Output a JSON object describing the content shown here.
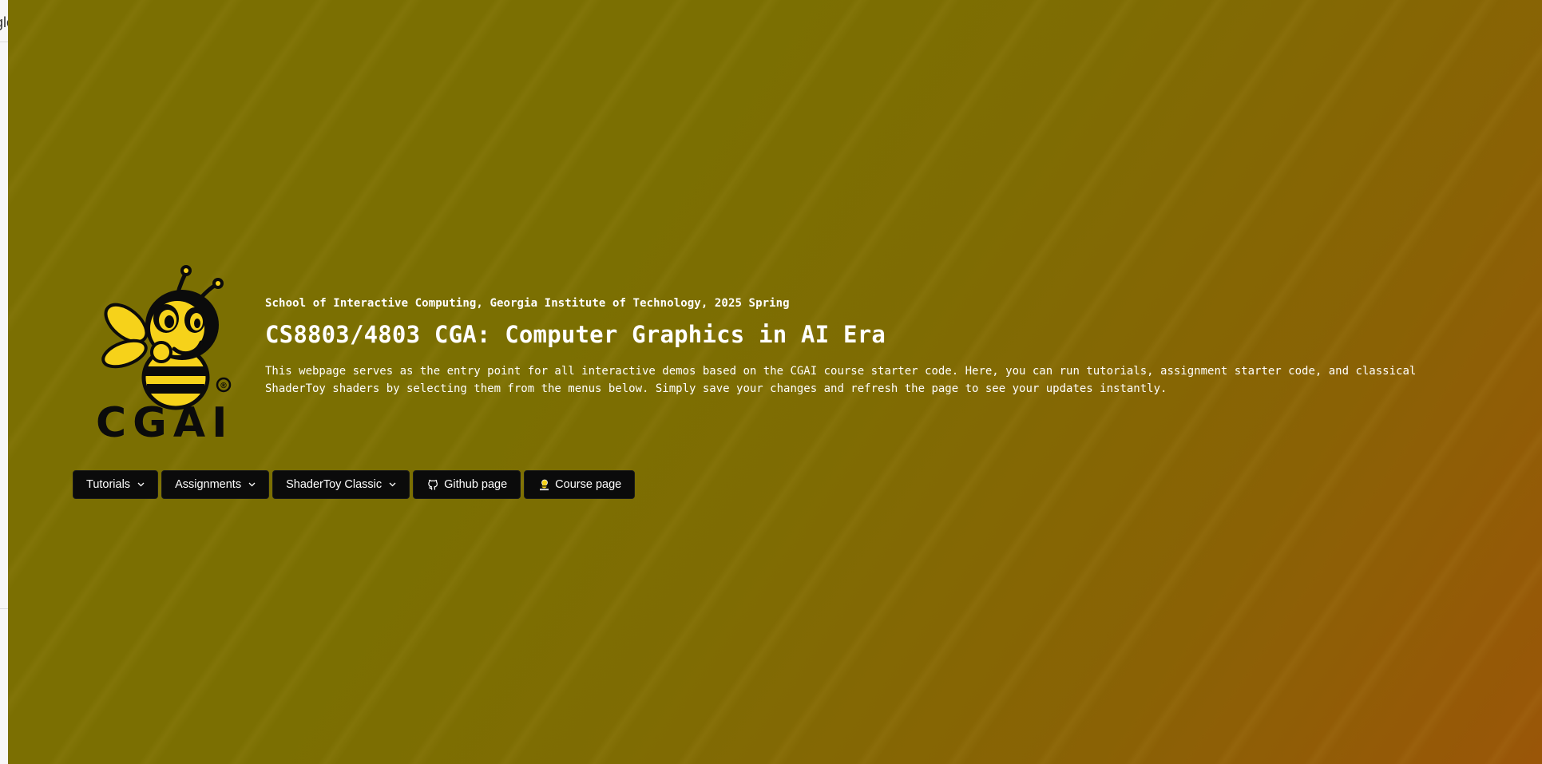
{
  "edge": {
    "fragment_text": "gle"
  },
  "header": {
    "subtitle": "School of Interactive Computing, Georgia Institute of Technology, 2025 Spring",
    "title": "CS8803/4803 CGA: Computer Graphics in AI Era",
    "description": "This webpage serves as the entry point for all interactive demos based on the CGAI course starter code. Here, you can run tutorials, assignment starter code, and classical ShaderToy shaders by selecting them from the menus below. Simply save your changes and refresh the page to see your updates instantly."
  },
  "logo": {
    "text": "CGAI",
    "registered_mark": "®",
    "icon": "bee-mascot-icon"
  },
  "toolbar": {
    "tutorials_label": "Tutorials",
    "assignments_label": "Assignments",
    "shadertoy_label": "ShaderToy Classic",
    "github_label": "Github page",
    "course_label": "Course page"
  },
  "colors": {
    "background_start": "#7b6f02",
    "background_end": "#9a5608",
    "button_bg": "#0b0b0b",
    "text": "#ffffff",
    "bee_yellow": "#f6d21a"
  },
  "icons": {
    "dropdown": "chevron-down-icon",
    "github": "github-icon",
    "course": "cgai-bee-icon"
  }
}
